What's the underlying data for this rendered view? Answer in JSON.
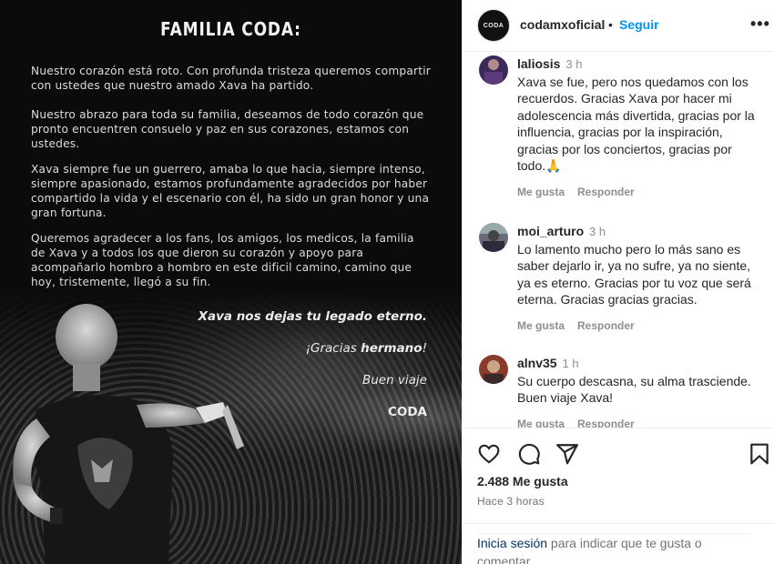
{
  "post": {
    "title": "FAMILIA CODA:",
    "paragraphs": [
      "Nuestro corazón está roto. Con profunda tristeza queremos compartir con ustedes que nuestro amado Xava ha partido.",
      "Nuestro abrazo para toda su familia, deseamos de todo corazón que pronto encuentren consuelo y paz en sus corazones, estamos con ustedes.",
      "Xava siempre fue un guerrero, amaba lo que hacia, siempre intenso, siempre apasionado, estamos profundamente agradecidos por haber compartido la vida y el escenario con él, ha sido un gran honor y una gran fortuna.",
      "Queremos agradecer a los fans, los amigos, los medicos, la familia de Xava y a todos los que dieron su corazón y apoyo para acompañarlo hombro a hombro en este dificil camino, camino que hoy, tristemente, llegó a su fin."
    ],
    "closing_line": "Xava nos dejas tu legado eterno.",
    "thanks_prefix": "¡Gracias ",
    "thanks_bold": "hermano",
    "thanks_suffix": "!",
    "farewell": "Buen viaje",
    "signature": "CODA"
  },
  "header": {
    "avatar_text": "CODA",
    "username": "codamxoficial",
    "separator": "•",
    "follow_label": "Seguir",
    "more_label": "•••"
  },
  "comments": [
    {
      "username": "laliosis",
      "time": "3 h",
      "text": "Xava se fue, pero nos quedamos con los recuerdos. Gracias Xava por hacer mi adolescencia más divertida, gracias por la influencia, gracias por la inspiración, gracias por los conciertos, gracias por todo.🙏",
      "like_label": "Me gusta",
      "reply_label": "Responder"
    },
    {
      "username": "moi_arturo",
      "time": "3 h",
      "text": "Lo lamento mucho pero lo más sano es saber dejarlo ir, ya no sufre, ya no siente, ya es eterno. Gracias por tu voz que será eterna. Gracias gracias gracias.",
      "like_label": "Me gusta",
      "reply_label": "Responder"
    },
    {
      "username": "alnv35",
      "time": "1 h",
      "text": "Su cuerpo descasna, su alma trasciende. Buen viaje Xava!",
      "like_label": "Me gusta",
      "reply_label": "Responder"
    }
  ],
  "actions": {
    "icons": [
      "heart-icon",
      "comment-icon",
      "share-icon",
      "bookmark-icon"
    ],
    "likes": "2.488 Me gusta",
    "posted": "Hace 3 horas",
    "login_link": "Inicia sesión",
    "login_rest": " para indicar que te gusta o comentar."
  },
  "colors": {
    "accent": "#0095f6",
    "link_dark": "#00376b",
    "muted": "#8e8e8e",
    "image_bg": "#0b0b0b"
  }
}
